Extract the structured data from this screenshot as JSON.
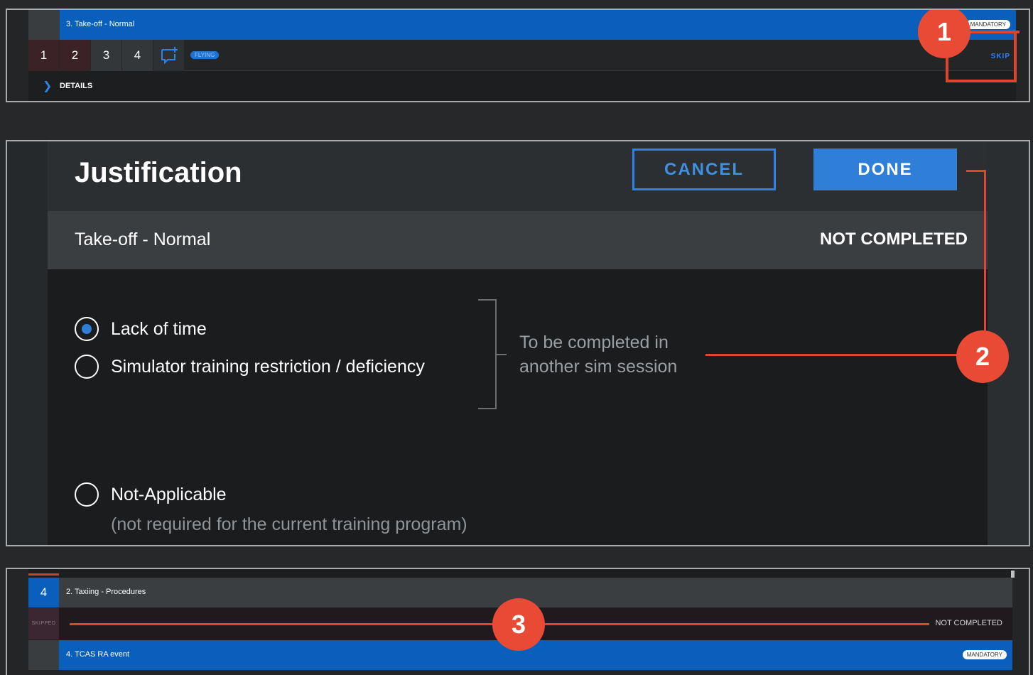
{
  "panel1": {
    "title": "3. Take-off - Normal",
    "mandatory": "MANDATORY",
    "grades": [
      "1",
      "2",
      "3",
      "4"
    ],
    "grade_colors": [
      "#3b2226",
      "#3b2226",
      "#34373a",
      "#34373a"
    ],
    "status_pill": "FLYING",
    "skip_label": "SKIP",
    "details_label": "DETAILS",
    "callout": "1"
  },
  "panel2": {
    "dialog_title": "Justification",
    "cancel_label": "CANCEL",
    "done_label": "DONE",
    "maneuver": "Take-off - Normal",
    "status": "NOT COMPLETED",
    "options": [
      {
        "label": "Lack of time",
        "selected": true
      },
      {
        "label": "Simulator training restriction / deficiency",
        "selected": false
      },
      {
        "label": "Not-Applicable",
        "selected": false
      }
    ],
    "group_note": "To be completed in another sim session",
    "na_note": "(not required for the current training program)",
    "callout": "2"
  },
  "panel3": {
    "row1_grade": "4",
    "row1_title": "2. Taxiing - Procedures",
    "skipped_label": "SKIPPED",
    "row2_status": "NOT COMPLETED",
    "row3_title": "4. TCAS RA event",
    "mandatory": "MANDATORY",
    "callout": "3"
  },
  "colors": {
    "accent_blue": "#0a5fbd",
    "annotation_red": "#e0432e"
  }
}
